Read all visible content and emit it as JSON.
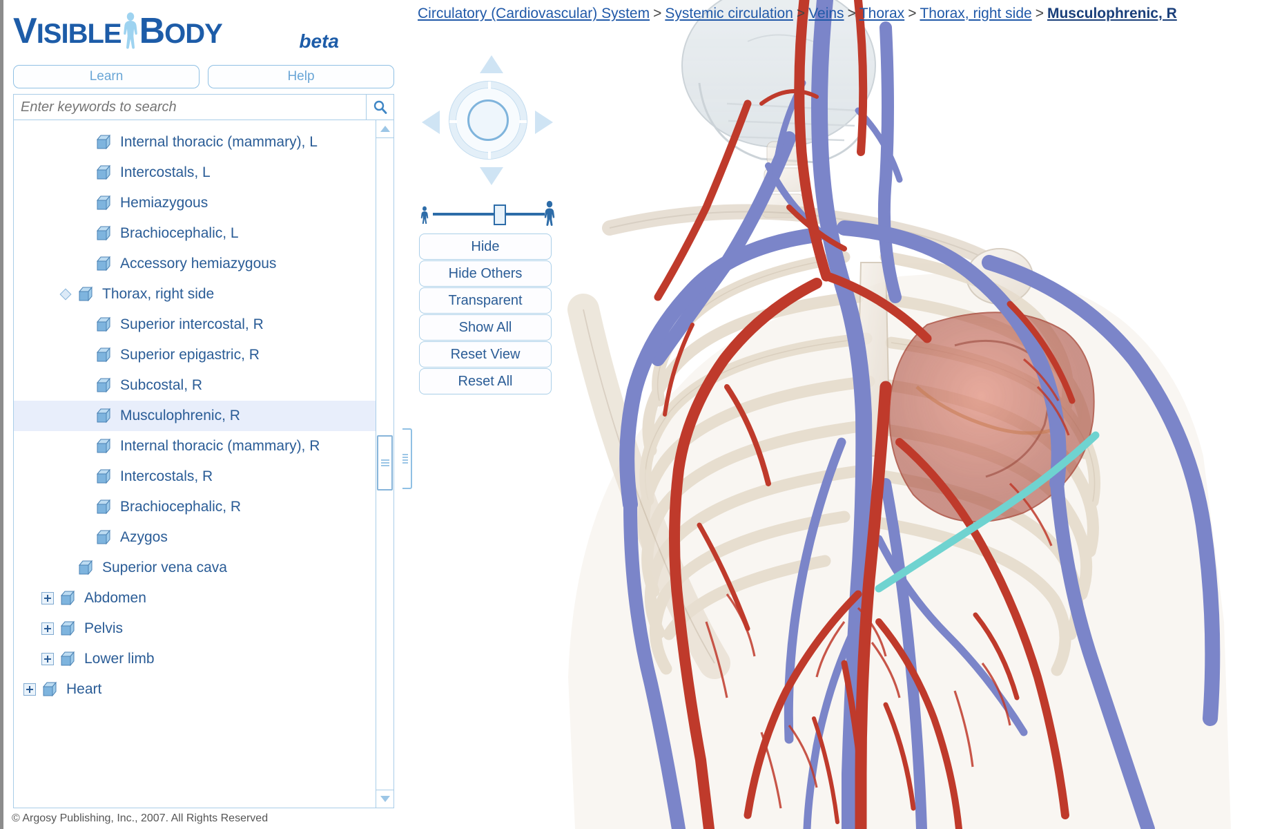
{
  "brand": {
    "name_part1": "V",
    "name_part2": "ISIBLE",
    "name_part3": "B",
    "name_part4": "ODY",
    "beta_label": "beta",
    "figure_icon": "body-figure-icon",
    "primary_color": "#1d5ca8"
  },
  "tabs": {
    "learn_label": "Learn",
    "help_label": "Help"
  },
  "search": {
    "placeholder": "Enter keywords to search",
    "value": "",
    "icon": "search-icon"
  },
  "tree": {
    "items": [
      {
        "label": "Internal thoracic (mammary), L",
        "indent": 3,
        "state": "leaf",
        "selected": false
      },
      {
        "label": "Intercostals, L",
        "indent": 3,
        "state": "leaf",
        "selected": false
      },
      {
        "label": "Hemiazygous",
        "indent": 3,
        "state": "leaf",
        "selected": false
      },
      {
        "label": "Brachiocephalic, L",
        "indent": 3,
        "state": "leaf",
        "selected": false
      },
      {
        "label": "Accessory hemiazygous",
        "indent": 3,
        "state": "leaf",
        "selected": false
      },
      {
        "label": "Thorax, right side",
        "indent": 2,
        "state": "expanded",
        "selected": false
      },
      {
        "label": "Superior intercostal, R",
        "indent": 3,
        "state": "leaf",
        "selected": false
      },
      {
        "label": "Superior epigastric, R",
        "indent": 3,
        "state": "leaf",
        "selected": false
      },
      {
        "label": "Subcostal, R",
        "indent": 3,
        "state": "leaf",
        "selected": false
      },
      {
        "label": "Musculophrenic, R",
        "indent": 3,
        "state": "leaf",
        "selected": true
      },
      {
        "label": "Internal thoracic (mammary), R",
        "indent": 3,
        "state": "leaf",
        "selected": false
      },
      {
        "label": "Intercostals, R",
        "indent": 3,
        "state": "leaf",
        "selected": false
      },
      {
        "label": "Brachiocephalic, R",
        "indent": 3,
        "state": "leaf",
        "selected": false
      },
      {
        "label": "Azygos",
        "indent": 3,
        "state": "leaf",
        "selected": false
      },
      {
        "label": "Superior vena cava",
        "indent": 2,
        "state": "leaf",
        "selected": false
      },
      {
        "label": "Abdomen",
        "indent": 1,
        "state": "collapsed",
        "selected": false
      },
      {
        "label": "Pelvis",
        "indent": 1,
        "state": "collapsed",
        "selected": false
      },
      {
        "label": "Lower limb",
        "indent": 1,
        "state": "collapsed",
        "selected": false
      },
      {
        "label": "Heart",
        "indent": 0,
        "state": "collapsed",
        "selected": false
      }
    ],
    "scrollbar": {
      "up_icon": "scroll-up-icon",
      "down_icon": "scroll-down-icon",
      "thumb": "scroll-thumb"
    }
  },
  "footer": {
    "copyright": "© Argosy Publishing, Inc., 2007. All Rights Reserved"
  },
  "breadcrumb": {
    "items": [
      {
        "label": "Circulatory (Cardiovascular) System",
        "current": false
      },
      {
        "label": "Systemic circulation",
        "current": false
      },
      {
        "label": "Veins",
        "current": false
      },
      {
        "label": "Thorax",
        "current": false
      },
      {
        "label": "Thorax, right side",
        "current": false
      },
      {
        "label": "Musculophrenic, R",
        "current": true
      }
    ],
    "separator": ">"
  },
  "navigation": {
    "up_icon": "rotate-up-icon",
    "down_icon": "rotate-down-icon",
    "left_icon": "rotate-left-icon",
    "right_icon": "rotate-right-icon",
    "dial_icon": "rotation-dial",
    "center_icon": "dial-center-knob"
  },
  "zoom": {
    "small_icon": "zoom-out-person-icon",
    "large_icon": "zoom-in-person-icon",
    "thumb_icon": "zoom-slider-thumb"
  },
  "actions": {
    "buttons": [
      {
        "label": "Hide"
      },
      {
        "label": "Hide Others"
      },
      {
        "label": "Transparent"
      },
      {
        "label": "Show All"
      },
      {
        "label": "Reset View"
      },
      {
        "label": "Reset All"
      }
    ]
  },
  "viewer": {
    "model_name": "circulatory-system-3d-model",
    "highlighted_structure": "Musculophrenic, R",
    "highlight_color": "#6fd3d0",
    "artery_color": "#c0392b",
    "vein_color": "#7b85c9",
    "bone_color": "#efe7dc",
    "heart_color": "#c9604f"
  },
  "splitter": {
    "icon": "panel-splitter-handle"
  }
}
